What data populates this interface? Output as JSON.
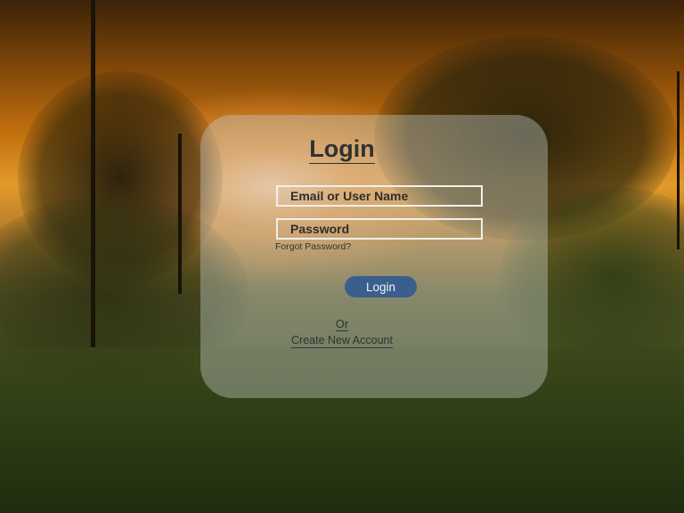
{
  "login_form": {
    "title": "Login",
    "username_placeholder": "Email or User Name",
    "password_placeholder": "Password",
    "forgot_password_link": "Forgot Password?",
    "login_button_label": "Login",
    "or_divider": "Or",
    "create_account_link": "Create New Account"
  },
  "colors": {
    "login_button": "#3a5f8e",
    "card_tint": "#bec8c3",
    "text": "#2e3333",
    "field_border": "#f2f0ea"
  }
}
